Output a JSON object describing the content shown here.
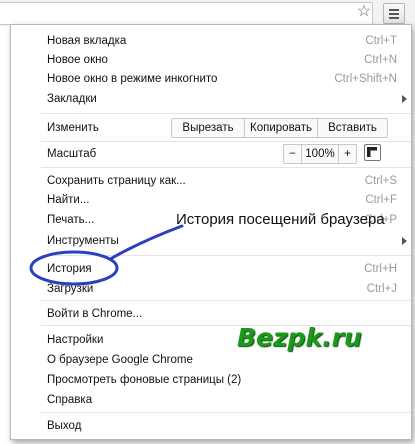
{
  "toolbar": {
    "star_icon": "star-icon",
    "menu_icon": "menu-icon"
  },
  "menu": {
    "new_tab": {
      "label": "Новая вкладка",
      "shortcut": "Ctrl+T"
    },
    "new_window": {
      "label": "Новое окно",
      "shortcut": "Ctrl+N"
    },
    "incognito": {
      "label": "Новое окно в режиме инкогнито",
      "shortcut": "Ctrl+Shift+N"
    },
    "bookmarks": {
      "label": "Закладки"
    },
    "edit": {
      "label": "Изменить",
      "cut": "Вырезать",
      "copy": "Копировать",
      "paste": "Вставить"
    },
    "zoom": {
      "label": "Масштаб",
      "minus": "−",
      "value": "100%",
      "plus": "+"
    },
    "save_page": {
      "label": "Сохранить страницу как...",
      "shortcut": "Ctrl+S"
    },
    "find": {
      "label": "Найти...",
      "shortcut": "Ctrl+F"
    },
    "print": {
      "label": "Печать...",
      "shortcut": "Ctrl+P"
    },
    "tools": {
      "label": "Инструменты"
    },
    "history": {
      "label": "История",
      "shortcut": "Ctrl+H"
    },
    "downloads": {
      "label": "Загрузки",
      "shortcut": "Ctrl+J"
    },
    "sign_in": {
      "label": "Войти в Chrome..."
    },
    "settings": {
      "label": "Настройки"
    },
    "about": {
      "label": "О браузере Google Chrome"
    },
    "background_pages": {
      "label": "Просмотреть фоновые страницы (2)"
    },
    "help": {
      "label": "Справка"
    },
    "exit": {
      "label": "Выход"
    }
  },
  "annotation": {
    "text": "История посещений браузера",
    "highlight_color": "#2b3fbf"
  },
  "watermark": {
    "text": "Bezpk.ru",
    "color": "#1a9a1a"
  }
}
